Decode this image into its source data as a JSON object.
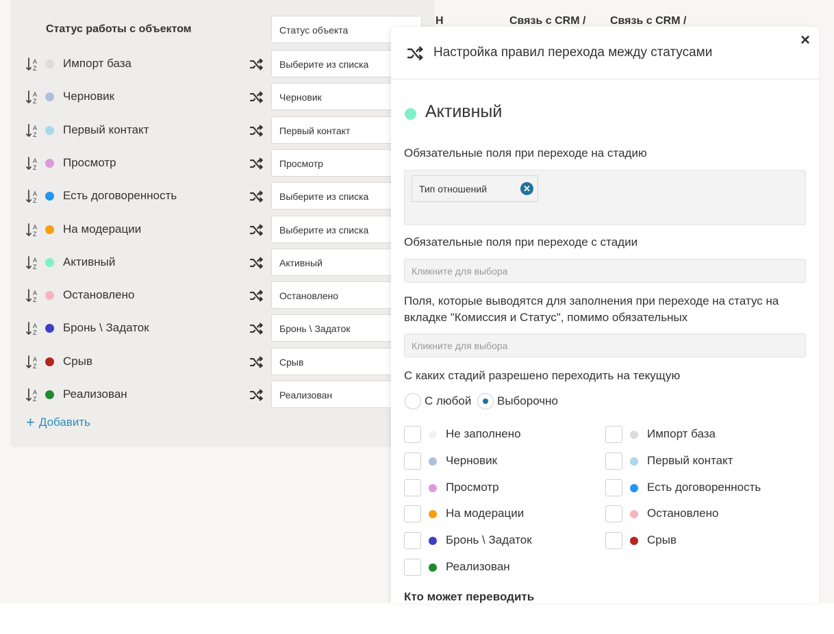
{
  "background": {
    "header": {
      "title": "Статус работы с объектом",
      "select_value": "Статус объекта",
      "col0": "Н",
      "col1": "Связь с CRM /",
      "col2": "Связь с CRM /"
    },
    "rows": [
      {
        "label": "Импорт база",
        "color": "#dcdcdc",
        "select": "Выберите из списка"
      },
      {
        "label": "Черновик",
        "color": "#aebfdc",
        "select": "Черновик"
      },
      {
        "label": "Первый контакт",
        "color": "#a9d8ea",
        "select": "Первый контакт"
      },
      {
        "label": "Просмотр",
        "color": "#dd9ad8",
        "select": "Просмотр"
      },
      {
        "label": "Есть договоренность",
        "color": "#2196f3",
        "select": "Выберите из списка"
      },
      {
        "label": "На модерации",
        "color": "#f5a00f",
        "select": "Выберите из списка"
      },
      {
        "label": "Активный",
        "color": "#7ef2c6",
        "select": "Активный"
      },
      {
        "label": "Остановлено",
        "color": "#f9b3bd",
        "select": "Остановлено"
      },
      {
        "label": "Бронь \\ Задаток",
        "color": "#3f3fc4",
        "select": "Бронь \\ Задаток"
      },
      {
        "label": "Срыв",
        "color": "#b3261e",
        "select": "Срыв"
      },
      {
        "label": "Реализован",
        "color": "#1e8a2e",
        "select": "Реализован"
      }
    ],
    "add_label": "Добавить"
  },
  "modal": {
    "title": "Настройка правил перехода между статусами",
    "close": "×",
    "status_name": "Активный",
    "status_color": "#7ef2c6",
    "required_to": {
      "label": "Обязательные поля при переходе на стадию",
      "tags": [
        "Тип отношений"
      ]
    },
    "required_from": {
      "label": "Обязательные поля при переходе с стадии",
      "placeholder": "Кликните для выбора"
    },
    "extra_fields": {
      "label": "Поля, которые выводятся для заполнения при переходе на статус на вкладке \"Комиссия и Статус\", помимо обязательных",
      "placeholder": "Кликните для выбора"
    },
    "allowed_from": {
      "label": "С каких стадий разрешено переходить на текущую",
      "options": [
        {
          "label": "С любой",
          "checked": false
        },
        {
          "label": "Выборочно",
          "checked": true
        }
      ],
      "statuses": [
        {
          "label": "Не заполнено",
          "color": "#f2f2f2"
        },
        {
          "label": "Импорт база",
          "color": "#dcdcdc"
        },
        {
          "label": "Черновик",
          "color": "#aebfdc"
        },
        {
          "label": "Первый контакт",
          "color": "#a9d8ea"
        },
        {
          "label": "Просмотр",
          "color": "#dd9ad8"
        },
        {
          "label": "Есть договоренность",
          "color": "#2196f3"
        },
        {
          "label": "На модерации",
          "color": "#f5a00f"
        },
        {
          "label": "Остановлено",
          "color": "#f9b3bd"
        },
        {
          "label": "Бронь \\ Задаток",
          "color": "#3f3fc4"
        },
        {
          "label": "Срыв",
          "color": "#b3261e"
        },
        {
          "label": "Реализован",
          "color": "#1e8a2e"
        }
      ]
    },
    "who_can": {
      "label": "Кто может переводить"
    }
  }
}
